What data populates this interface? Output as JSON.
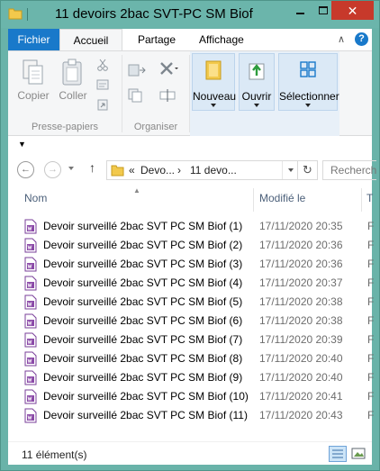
{
  "window": {
    "title": "11 devoirs 2bac SVT-PC  SM Biof",
    "minimize_icon": "minimize-icon",
    "maximize_icon": "maximize-icon",
    "close_label": "✕"
  },
  "ribbon_tabs": {
    "file": "Fichier",
    "home": "Accueil",
    "share": "Partage",
    "view": "Affichage",
    "expand_glyph": "∧",
    "help_glyph": "?"
  },
  "ribbon": {
    "clipboard_group": "Presse-papiers",
    "copy": "Copier",
    "paste": "Coller",
    "organize_group": "Organiser",
    "new": "Nouveau",
    "open": "Ouvrir",
    "select": "Sélectionner"
  },
  "quick_access": {
    "glyph": "▼"
  },
  "address": {
    "back_glyph": "←",
    "forward_glyph": "→",
    "up_glyph": "↑",
    "chevrons": "«",
    "crumb1": "Devo...",
    "sep": "›",
    "crumb2": "11 devo...",
    "refresh_glyph": "↻",
    "search_placeholder": "Rechercher"
  },
  "columns": {
    "name": "Nom",
    "modified": "Modifié le",
    "type_initial": "T"
  },
  "files": [
    {
      "name": "Devoir surveillé  2bac SVT PC SM Biof (1)",
      "modified": "17/11/2020 20:35",
      "type": "F"
    },
    {
      "name": "Devoir surveillé  2bac SVT PC SM Biof (2)",
      "modified": "17/11/2020 20:36",
      "type": "F"
    },
    {
      "name": "Devoir surveillé  2bac SVT PC SM Biof (3)",
      "modified": "17/11/2020 20:36",
      "type": "F"
    },
    {
      "name": "Devoir surveillé  2bac SVT PC SM Biof (4)",
      "modified": "17/11/2020 20:37",
      "type": "F"
    },
    {
      "name": "Devoir surveillé  2bac SVT PC SM Biof (5)",
      "modified": "17/11/2020 20:38",
      "type": "F"
    },
    {
      "name": "Devoir surveillé  2bac SVT PC SM Biof (6)",
      "modified": "17/11/2020 20:38",
      "type": "F"
    },
    {
      "name": "Devoir surveillé  2bac SVT PC SM Biof (7)",
      "modified": "17/11/2020 20:39",
      "type": "F"
    },
    {
      "name": "Devoir surveillé  2bac SVT PC SM Biof (8)",
      "modified": "17/11/2020 20:40",
      "type": "F"
    },
    {
      "name": "Devoir surveillé  2bac SVT PC SM Biof (9)",
      "modified": "17/11/2020 20:40",
      "type": "F"
    },
    {
      "name": "Devoir surveillé  2bac SVT PC SM Biof (10)",
      "modified": "17/11/2020 20:41",
      "type": "F"
    },
    {
      "name": "Devoir surveillé  2bac SVT PC SM Biof (11)",
      "modified": "17/11/2020 20:43",
      "type": "F"
    }
  ],
  "status": {
    "count": "11 élément(s)"
  },
  "colors": {
    "title_bar": "#6bb5ab",
    "file_tab": "#1979ca",
    "close_button": "#c7392b",
    "selected_ribbon": "#dbe9f6"
  }
}
